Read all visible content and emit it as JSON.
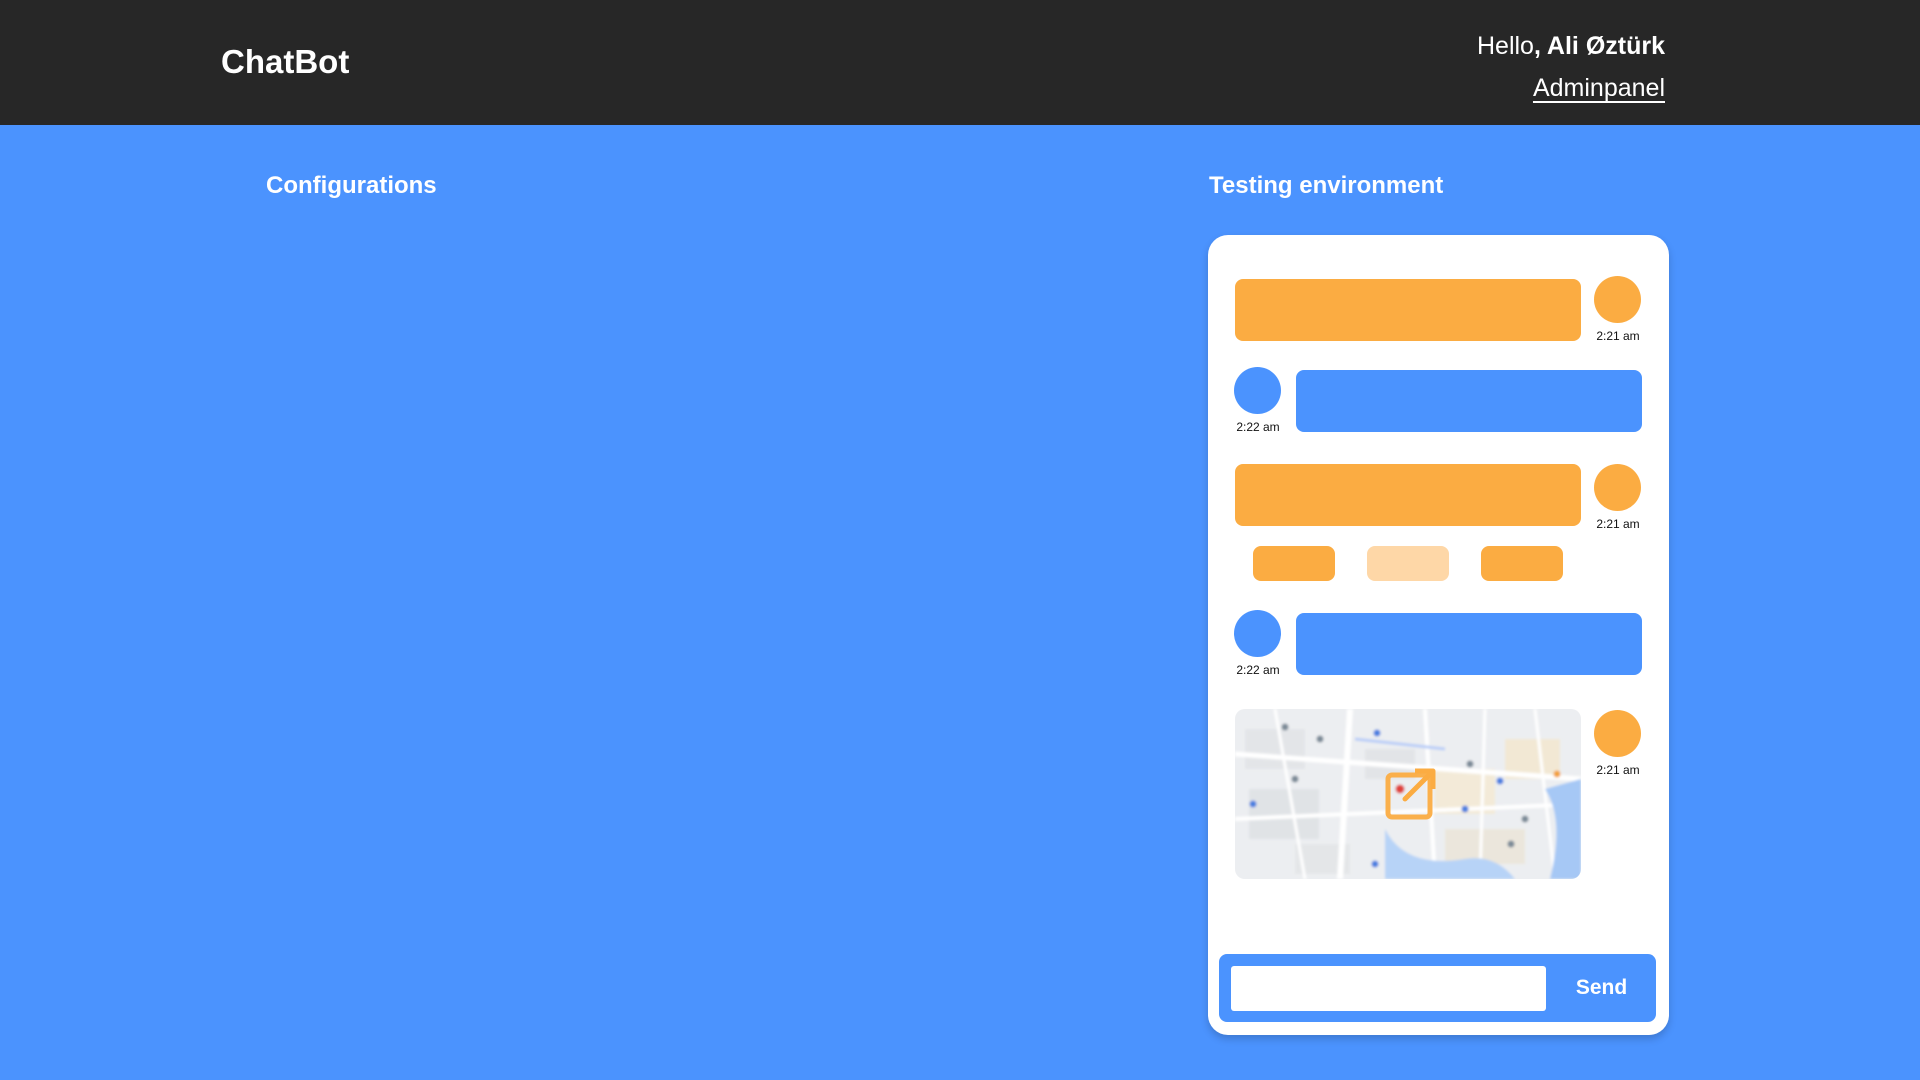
{
  "header": {
    "brand": "ChatBot",
    "greeting_prefix": "Hello",
    "greeting_user": ", Ali Øztürk",
    "admin_link": "Adminpanel"
  },
  "sections": {
    "configurations_title": "Configurations",
    "testing_title": "Testing environment"
  },
  "chat": {
    "messages": [
      {
        "sender": "bot",
        "time": "2:21 am"
      },
      {
        "sender": "user",
        "time": "2:22 am"
      },
      {
        "sender": "bot",
        "time": "2:21 am"
      },
      {
        "sender": "user",
        "time": "2:22 am"
      },
      {
        "sender": "bot",
        "type": "map",
        "time": "2:21 am",
        "icon": "external-link-icon"
      }
    ],
    "quick_replies_count": 3,
    "send_label": "Send",
    "input_value": ""
  },
  "colors": {
    "background": "#4b93fe",
    "header": "#272727",
    "bot": "#fbac42",
    "bot_light": "#fed7a7",
    "user": "#4b93fe"
  }
}
